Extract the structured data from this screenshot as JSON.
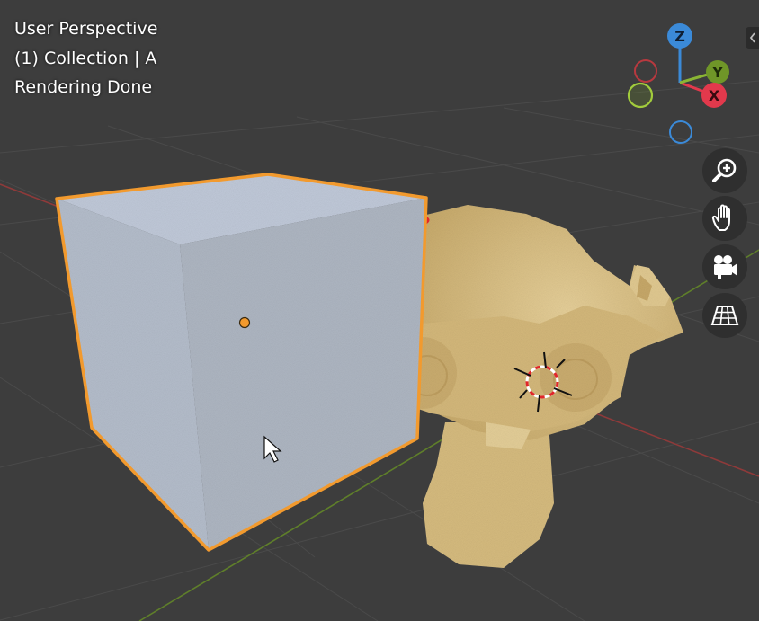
{
  "viewport": {
    "view_name": "User Perspective",
    "collection_info": "(1) Collection | A",
    "render_status": "Rendering Done"
  },
  "gizmo": {
    "x_label": "X",
    "y_label": "Y",
    "z_label": "Z",
    "colors": {
      "x": "#e2394c",
      "y": "#8ab534",
      "z": "#3b8ad8"
    }
  },
  "navigation": {
    "zoom_icon": "zoom-in-icon",
    "pan_icon": "hand-icon",
    "camera_icon": "camera-icon",
    "ortho_icon": "grid-perspective-icon"
  },
  "colors": {
    "background": "#3d3d3d",
    "selection_outline": "#f29a2e",
    "cube": "#b4bcc8",
    "monkey": "#d9be82"
  }
}
